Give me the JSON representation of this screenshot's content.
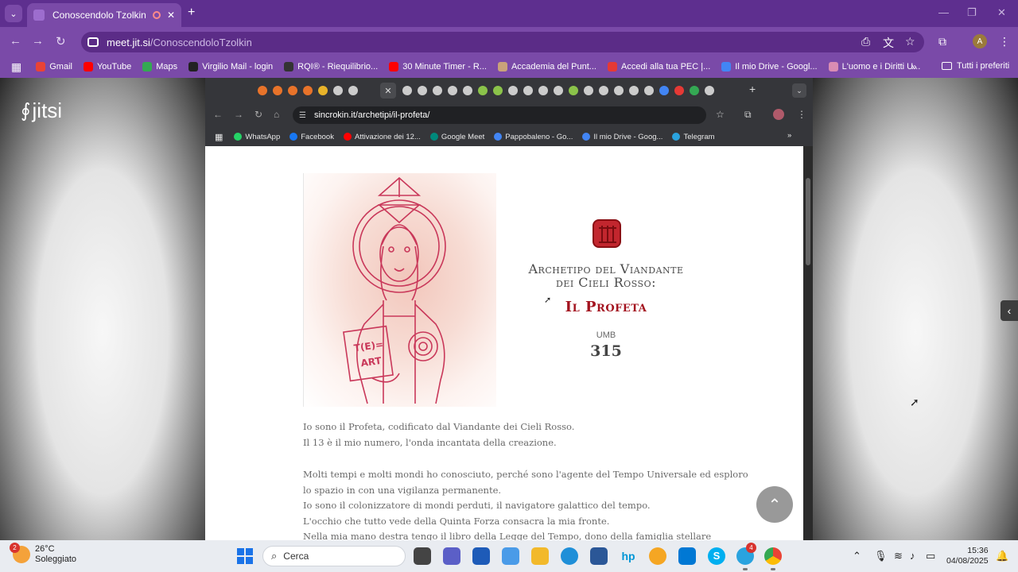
{
  "browser": {
    "tab_title": "Conoscendolo Tzolkin | Jitsi",
    "url_domain": "meet.jit.si",
    "url_path": "/ConoscendoloTzolkin",
    "avatar_letter": "A",
    "bookmarks": [
      {
        "label": "Gmail",
        "color": "#ea4335"
      },
      {
        "label": "YouTube",
        "color": "#ff0000"
      },
      {
        "label": "Maps",
        "color": "#34a853"
      },
      {
        "label": "Virgilio Mail - login",
        "color": "#222222"
      },
      {
        "label": "RQI® - Riequilibrio...",
        "color": "#333333"
      },
      {
        "label": "30 Minute Timer - R...",
        "color": "#ff0000"
      },
      {
        "label": "Accademia del Punt...",
        "color": "#c9a27a"
      },
      {
        "label": "Accedi alla tua PEC |...",
        "color": "#e53935"
      },
      {
        "label": "Il mio Drive - Googl...",
        "color": "#4285f4"
      },
      {
        "label": "L'uomo e i Diritti U...",
        "color": "#d98cb3"
      }
    ],
    "bookmarks_all": "Tutti i preferiti"
  },
  "jitsi": {
    "logo": "jitsi"
  },
  "inner_browser": {
    "url": "sincrokin.it/archetipi/il-profeta/",
    "bookmarks": [
      {
        "label": "WhatsApp",
        "color": "#25d366"
      },
      {
        "label": "Facebook",
        "color": "#1877f2"
      },
      {
        "label": "Attivazione dei 12...",
        "color": "#ff0000"
      },
      {
        "label": "Google Meet",
        "color": "#00897b"
      },
      {
        "label": "Pappobaleno - Go...",
        "color": "#4285f4"
      },
      {
        "label": "Il mio Drive - Goog...",
        "color": "#4285f4"
      },
      {
        "label": "Telegram",
        "color": "#2aa3df"
      }
    ]
  },
  "page": {
    "title_line1": "Archetipo del Viandante",
    "title_line2": "dei Cieli Rosso:",
    "archetype_name": "Il Profeta",
    "umb_label": "UMB",
    "umb_number": "315",
    "para1": [
      "Io sono il Profeta, codificato dal Viandante dei Cieli Rosso.",
      "Il 13 è il mio numero, l'onda incantata della creazione."
    ],
    "para2": [
      "Molti tempi e molti mondi ho conosciuto, perché sono l'agente del Tempo Universale ed esploro",
      "lo spazio in con una vigilanza permanente.",
      "Io sono il colonizzatore di mondi perduti, il navigatore galattico del tempo.",
      "L'occhio che tutto vede della Quinta Forza consacra la mia fronte.",
      "Nella mia mano destra tengo il libro della Legge del Tempo, dono della famiglia stellare"
    ],
    "accent_color": "#a3131f"
  },
  "taskbar": {
    "weather_badge": "2",
    "temperature": "26°C",
    "condition": "Soleggiato",
    "search_placeholder": "Cerca",
    "telegram_badge": "4",
    "time": "15:36",
    "date": "04/08/2025"
  }
}
